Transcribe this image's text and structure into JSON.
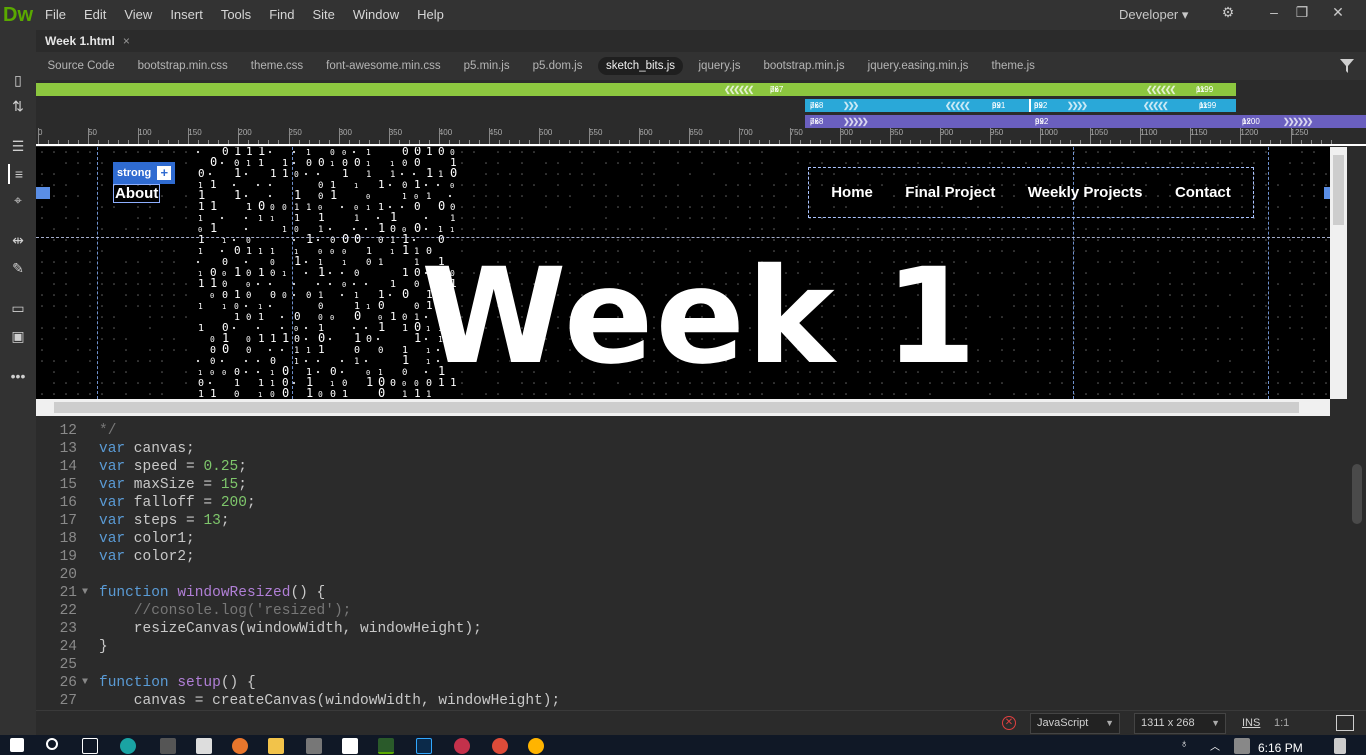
{
  "app": {
    "logo": "Dw",
    "workspace": "Developer ▾"
  },
  "menu": [
    "File",
    "Edit",
    "View",
    "Insert",
    "Tools",
    "Find",
    "Site",
    "Window",
    "Help"
  ],
  "document": {
    "tab": "Week 1.html",
    "close": "×"
  },
  "related_files": [
    "Source Code",
    "bootstrap.min.css",
    "theme.css",
    "font-awesome.min.css",
    "p5.min.js",
    "p5.dom.js",
    "sketch_bits.js",
    "jquery.js",
    "bootstrap.min.js",
    "jquery.easing.min.js",
    "theme.js"
  ],
  "active_related_file": "sketch_bits.js",
  "media_queries": {
    "green": {
      "left": "767",
      "right": "1199",
      "unit": "px"
    },
    "blue_a": {
      "start": "768",
      "end": "991",
      "unit": "px"
    },
    "blue_b": {
      "start": "992",
      "end": "1199",
      "unit": "px"
    },
    "purple_a": {
      "start": "768",
      "unit": "px"
    },
    "purple_b": {
      "start": "992",
      "unit": "px"
    },
    "purple_c": {
      "start": "1200",
      "unit": "px"
    }
  },
  "ruler": [
    "0",
    "50",
    "100",
    "150",
    "200",
    "250",
    "300",
    "350",
    "400",
    "450",
    "500",
    "550",
    "600",
    "650",
    "700",
    "750",
    "800",
    "850",
    "900",
    "950",
    "1000",
    "1050",
    "1100",
    "1150",
    "1200",
    "1250"
  ],
  "design": {
    "badge": "strong",
    "badge_plus": "+",
    "about": "About",
    "nav": [
      "Home",
      "Final Project",
      "Weekly Projects",
      "Contact"
    ],
    "hero": "Week 1"
  },
  "code": [
    {
      "n": "12",
      "t": "*/",
      "cls": "cm"
    },
    {
      "n": "13",
      "html": "<span class='kw'>var</span> canvas;"
    },
    {
      "n": "14",
      "html": "<span class='kw'>var</span> speed = <span class='num'>0.25</span>;"
    },
    {
      "n": "15",
      "html": "<span class='kw'>var</span> maxSize = <span class='num'>15</span>;"
    },
    {
      "n": "16",
      "html": "<span class='kw'>var</span> falloff = <span class='num'>200</span>;"
    },
    {
      "n": "17",
      "html": "<span class='kw'>var</span> steps = <span class='num'>13</span>;"
    },
    {
      "n": "18",
      "html": "<span class='kw'>var</span> color1;"
    },
    {
      "n": "19",
      "html": "<span class='kw'>var</span> color2;"
    },
    {
      "n": "20",
      "html": ""
    },
    {
      "n": "21",
      "fold": true,
      "html": "<span class='kw'>function</span> <span class='fn'>windowResized</span>() {"
    },
    {
      "n": "22",
      "html": "    <span class='cm'>//console.log('resized');</span>"
    },
    {
      "n": "23",
      "html": "    resizeCanvas(windowWidth, windowHeight);"
    },
    {
      "n": "24",
      "html": "}"
    },
    {
      "n": "25",
      "html": ""
    },
    {
      "n": "26",
      "fold": true,
      "html": "<span class='kw'>function</span> <span class='fn'>setup</span>() {"
    },
    {
      "n": "27",
      "html": "    canvas = createCanvas(windowWidth, windowHeight);"
    }
  ],
  "status": {
    "language": "JavaScript",
    "size": "1311 x 268",
    "mode": "INS",
    "position": "1:1"
  },
  "taskbar": {
    "clock": "6:16 PM"
  },
  "colors": {
    "green": "#8cc63f",
    "blue": "#2aa8d8",
    "purple": "#6a5fbf",
    "accent": "#2f6bd1"
  }
}
